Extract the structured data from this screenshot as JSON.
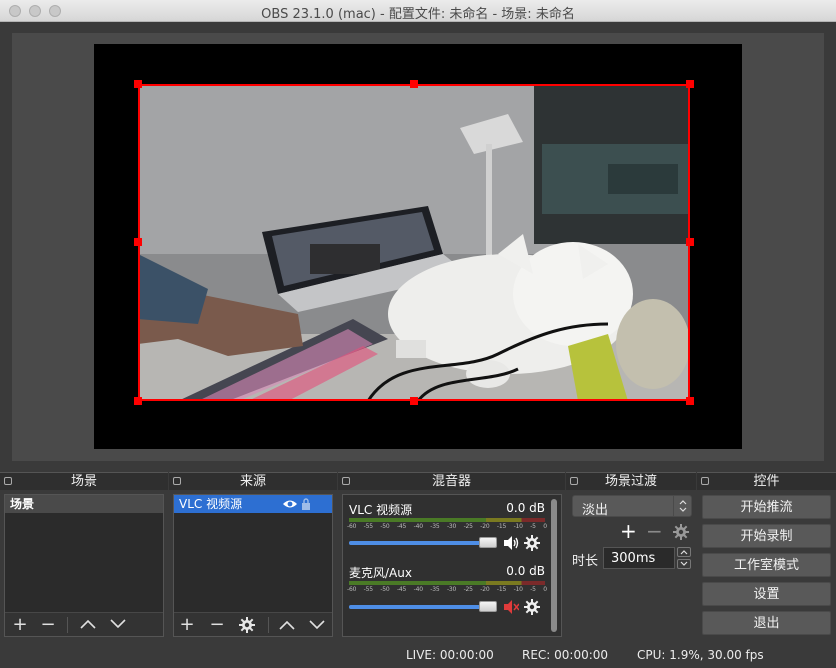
{
  "window": {
    "title": "OBS 23.1.0 (mac) - 配置文件: 未命名 - 场景: 未命名"
  },
  "docks": {
    "scenes": {
      "title": "场景",
      "items": [
        "场景"
      ]
    },
    "sources": {
      "title": "来源",
      "items": [
        "VLC 视频源"
      ]
    },
    "mixer": {
      "title": "混音器",
      "scale_labels": [
        "-60",
        "-55",
        "-50",
        "-45",
        "-40",
        "-35",
        "-30",
        "-25",
        "-20",
        "-15",
        "-10",
        "-5",
        "0"
      ],
      "channels": [
        {
          "name": "VLC 视频源",
          "db": "0.0 dB",
          "volume": 1.0,
          "muted": false
        },
        {
          "name": "麦克风/Aux",
          "db": "0.0 dB",
          "volume": 1.0,
          "muted": true
        }
      ]
    },
    "transitions": {
      "title": "场景过渡",
      "selected": "淡出",
      "duration_label": "时长",
      "duration_value": "300ms"
    },
    "controls": {
      "title": "控件",
      "buttons": [
        "开始推流",
        "开始录制",
        "工作室模式",
        "设置",
        "退出"
      ]
    }
  },
  "status": {
    "live": "LIVE: 00:00:00",
    "rec": "REC: 00:00:00",
    "cpu": "CPU: 1.9%, 30.00 fps"
  },
  "colors": {
    "selection": "#ff0000",
    "accent": "#2d6fd2",
    "mute_red": "#e03b3b"
  }
}
